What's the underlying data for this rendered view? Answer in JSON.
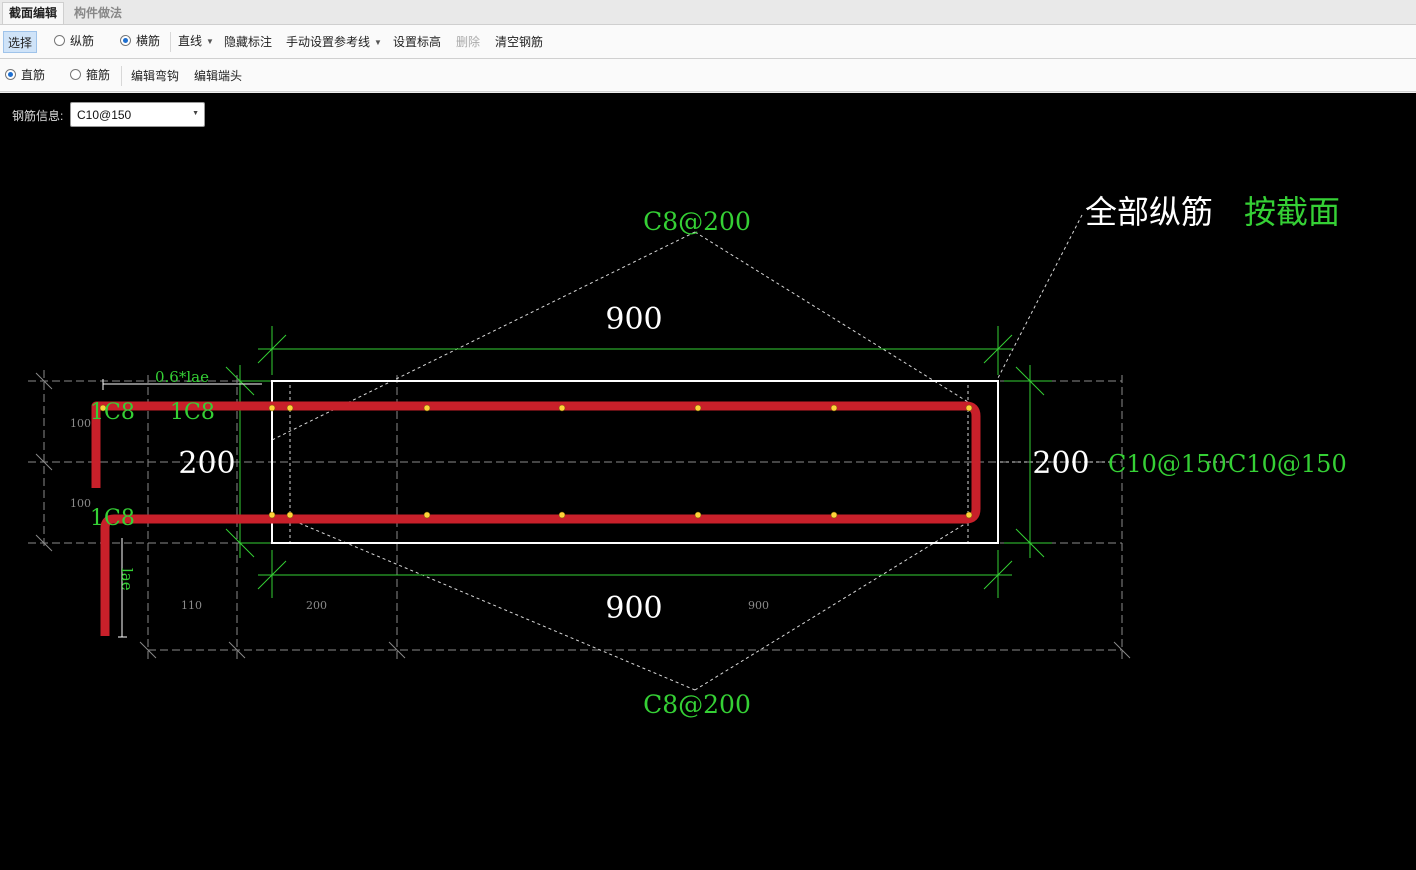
{
  "tabs": [
    "截面编辑",
    "构件做法"
  ],
  "toolbar1": {
    "select": "选择",
    "longitudinal": "纵筋",
    "transverse": "横筋",
    "line": "直线",
    "hide_labels": "隐藏标注",
    "manual_ref": "手动设置参考线",
    "set_elevation": "设置标高",
    "delete": "删除",
    "clear": "清空钢筋"
  },
  "toolbar2": {
    "straight": "直筋",
    "stirrup": "箍筋",
    "edit_hook": "编辑弯钩",
    "edit_end": "编辑端头"
  },
  "rebar_info": {
    "label": "钢筋信息:",
    "value": "C10@150"
  },
  "drawing": {
    "top_label": "C8@200",
    "bottom_label": "C8@200",
    "all_longitudinal": "全部纵筋",
    "by_section": "按截面",
    "top_dim": "900",
    "bottom_dim": "900",
    "left_dim": "200",
    "right_dim": "200",
    "right_label_1": "C10@150",
    "right_label_2": "C10@150",
    "rebar_top_1": "1C8",
    "rebar_top_2": "1C8",
    "rebar_bottom": "1C8",
    "anchor_label": "0.6*lae",
    "lae_label": "lae",
    "small_100_a": "100",
    "small_100_b": "100",
    "grid_110": "110",
    "grid_200": "200",
    "grid_900": "900"
  },
  "colors": {
    "rebar": "#c8202a",
    "dim": "#35d035",
    "canvas": "#000000",
    "outline": "#ffffff",
    "node": "#ffd23a"
  }
}
